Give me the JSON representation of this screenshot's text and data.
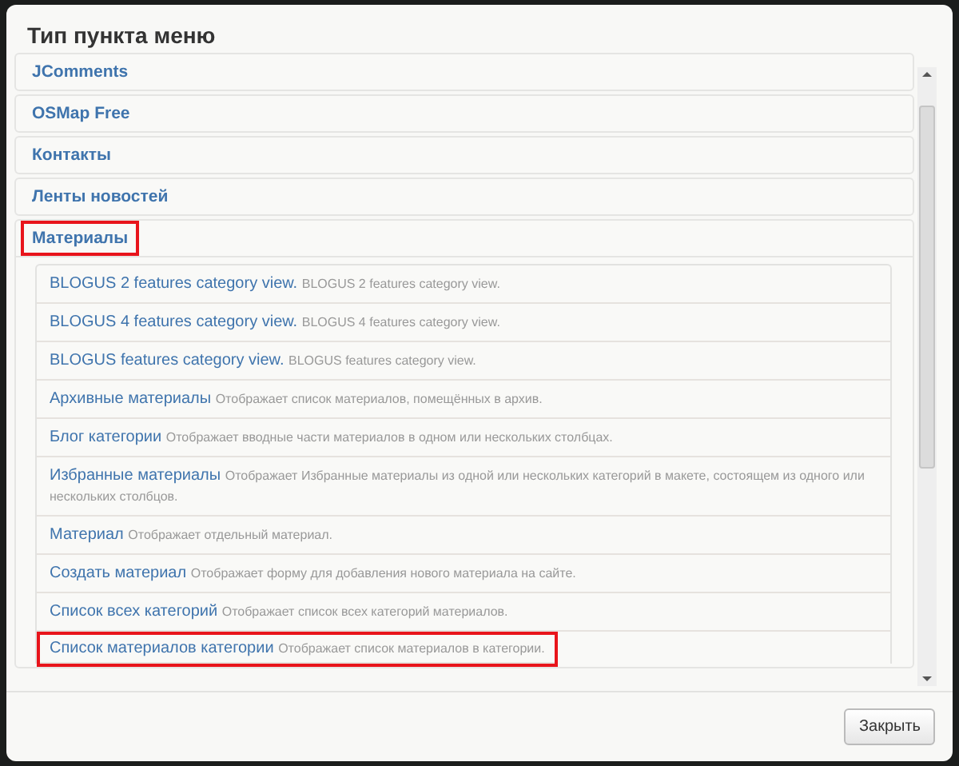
{
  "dialog": {
    "title": "Тип пункта меню"
  },
  "groups": [
    {
      "label": "JComments",
      "expanded": false,
      "highlighted": false
    },
    {
      "label": "OSMap Free",
      "expanded": false,
      "highlighted": false
    },
    {
      "label": "Контакты",
      "expanded": false,
      "highlighted": false
    },
    {
      "label": "Ленты новостей",
      "expanded": false,
      "highlighted": false
    },
    {
      "label": "Материалы",
      "expanded": true,
      "highlighted": true,
      "items": [
        {
          "title": "BLOGUS 2 features category view.",
          "description": "BLOGUS 2 features category view.",
          "highlighted": false
        },
        {
          "title": "BLOGUS 4 features category view.",
          "description": "BLOGUS 4 features category view.",
          "highlighted": false
        },
        {
          "title": "BLOGUS features category view.",
          "description": "BLOGUS features category view.",
          "highlighted": false
        },
        {
          "title": "Архивные материалы",
          "description": "Отображает список материалов, помещённых в архив.",
          "highlighted": false
        },
        {
          "title": "Блог категории",
          "description": "Отображает вводные части материалов в одном или нескольких столбцах.",
          "highlighted": false
        },
        {
          "title": "Избранные материалы",
          "description": "Отображает Избранные материалы из одной или нескольких категорий в макете, состоящем из одного или нескольких столбцов.",
          "highlighted": false
        },
        {
          "title": "Материал",
          "description": "Отображает отдельный материал.",
          "highlighted": false
        },
        {
          "title": "Создать материал",
          "description": "Отображает форму для добавления нового материала на сайте.",
          "highlighted": false
        },
        {
          "title": "Список всех категорий",
          "description": "Отображает список всех категорий материалов.",
          "highlighted": false
        },
        {
          "title": "Список материалов категории",
          "description": "Отображает список материалов в категории.",
          "highlighted": true
        }
      ]
    }
  ],
  "buttons": [
    {
      "label": "Закрыть"
    }
  ]
}
